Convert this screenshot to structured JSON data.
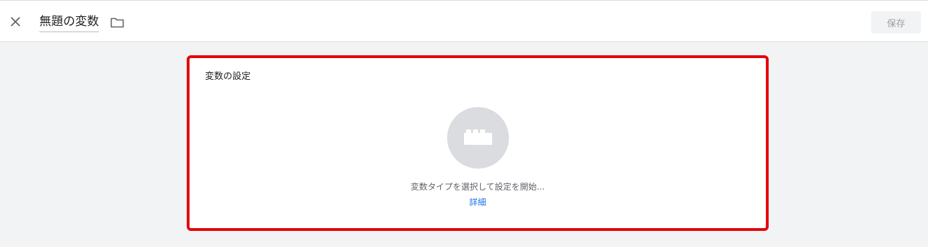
{
  "header": {
    "title": "無題の変数",
    "save_label": "保存",
    "close_icon": "close-icon",
    "folder_icon": "folder-icon"
  },
  "card": {
    "title": "変数の設定",
    "placeholder_icon": "block-icon",
    "hint": "変数タイプを選択して設定を開始...",
    "link_label": "詳細"
  },
  "colors": {
    "highlight": "#e5000a",
    "link": "#1a73e8",
    "background": "#f1f3f4",
    "circle": "#dadce0"
  }
}
